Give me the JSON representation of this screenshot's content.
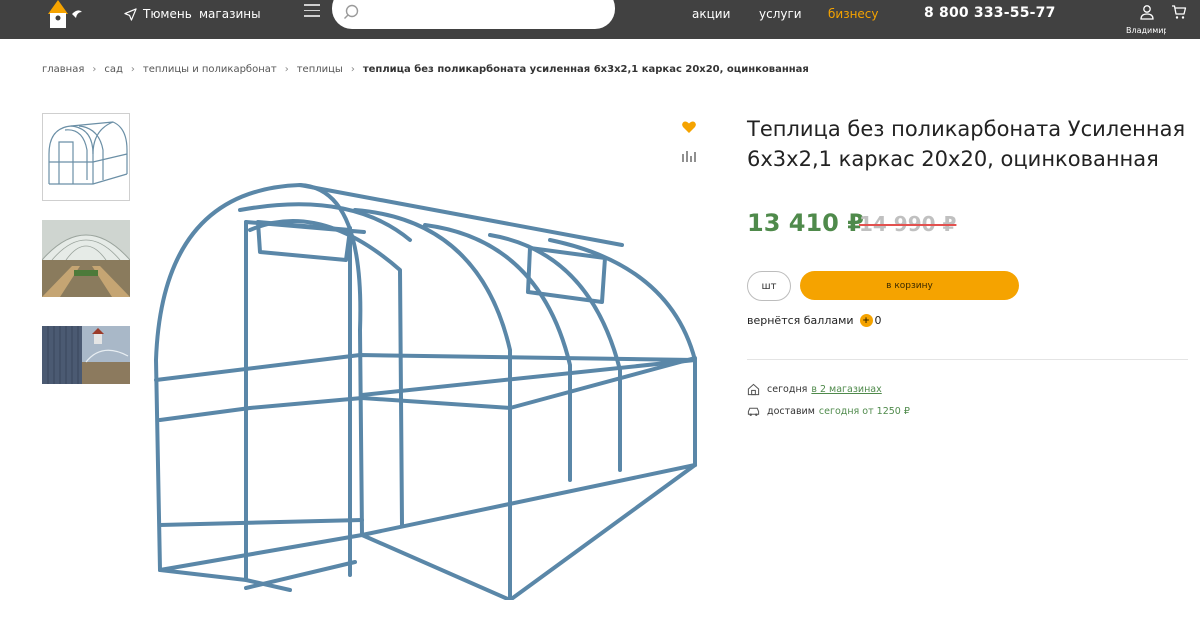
{
  "header": {
    "city": "Тюмень",
    "stores": "магазины",
    "search_placeholder": "",
    "nav": [
      "акции",
      "услуги",
      "бизнесу"
    ],
    "phone": "8 800 333-55-77",
    "user_name": "Владимир"
  },
  "breadcrumb": [
    "главная",
    "сад",
    "теплицы и поликарбонат",
    "теплицы",
    "теплица без поликарбоната усиленная 6х3х2,1 каркас 20х20, оцинкованная"
  ],
  "product": {
    "title": "Теплица без поликарбоната Усиленная 6х3х2,1 каркас 20х20, оцинкованная",
    "price": "13 410 ₽",
    "old_price": "14 990 ₽",
    "unit": "шт",
    "cart_label": "в корзину",
    "bonus_label": "вернётся баллами",
    "bonus_value": "0",
    "availability_prefix": "сегодня",
    "availability_link": "в 2 магазинах",
    "delivery_prefix": "доставим",
    "delivery_value": "сегодня от 1250 ₽"
  },
  "colors": {
    "accent": "#f5a300",
    "price_green": "#4f8a4b",
    "header_bg": "#414141"
  }
}
